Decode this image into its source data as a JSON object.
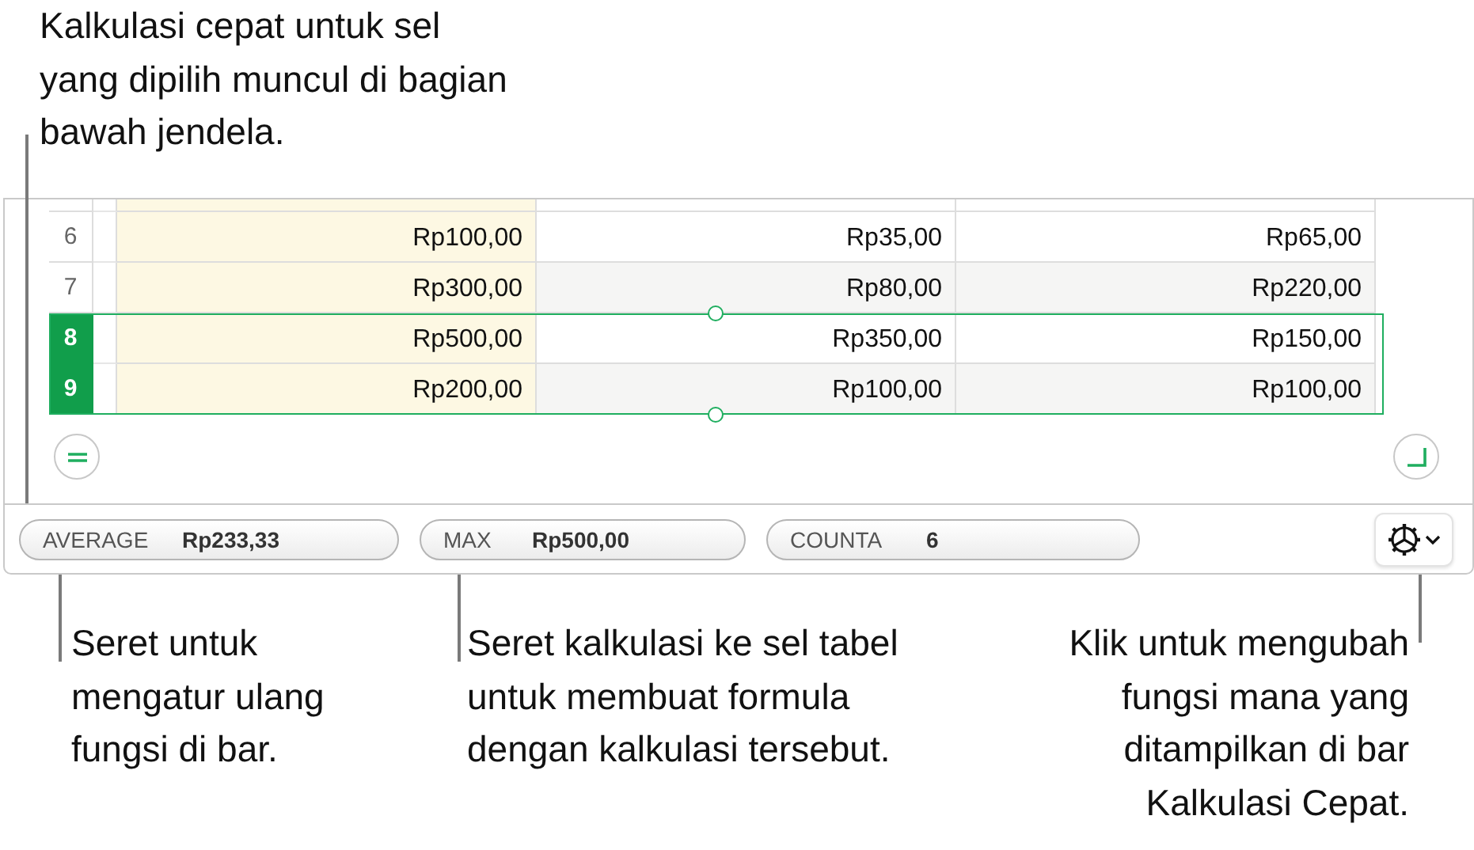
{
  "top_note": {
    "text": "Kalkulasi cepat untuk sel yang dipilih muncul di bagian bawah jendela."
  },
  "table": {
    "rows": [
      {
        "number": "6",
        "cells": [
          "Rp100,00",
          "Rp35,00",
          "Rp65,00"
        ],
        "selected": false
      },
      {
        "number": "7",
        "cells": [
          "Rp300,00",
          "Rp80,00",
          "Rp220,00"
        ],
        "selected": false
      },
      {
        "number": "8",
        "cells": [
          "Rp500,00",
          "Rp350,00",
          "Rp150,00"
        ],
        "selected": true
      },
      {
        "number": "9",
        "cells": [
          "Rp200,00",
          "Rp100,00",
          "Rp100,00"
        ],
        "selected": true
      }
    ]
  },
  "quick_calc": [
    {
      "label": "AVERAGE",
      "value": "Rp233,33"
    },
    {
      "label": "MAX",
      "value": "Rp500,00"
    },
    {
      "label": "COUNTA",
      "value": "6"
    }
  ],
  "bottom_notes": [
    {
      "text": "Seret untuk mengatur ulang fungsi di bar."
    },
    {
      "text": "Seret kalkulasi ke sel tabel untuk membuat formula dengan kalkulasi tersebut."
    },
    {
      "text": "Klik untuk mengubah fungsi mana yang ditampilkan di bar Kalkulasi Cepat."
    }
  ]
}
